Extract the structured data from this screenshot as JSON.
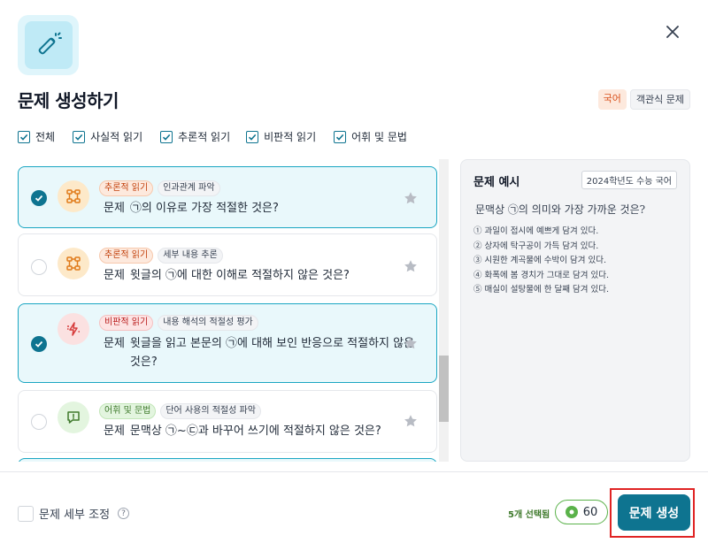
{
  "dialog": {
    "title": "문제 생성하기",
    "tags": {
      "subject": "국어",
      "type": "객관식 문제"
    }
  },
  "filters": [
    {
      "label": "전체",
      "checked": true
    },
    {
      "label": "사실적 읽기",
      "checked": true
    },
    {
      "label": "추론적 읽기",
      "checked": true
    },
    {
      "label": "비판적 읽기",
      "checked": true
    },
    {
      "label": "어휘 및 문법",
      "checked": true
    }
  ],
  "questions": [
    {
      "selected": true,
      "category": "추론적 읽기",
      "subcategory": "인과관계 파악",
      "prefix": "문제",
      "text": "㉠의 이유로 가장 적절한 것은?",
      "icon": "diagram-icon"
    },
    {
      "selected": false,
      "category": "추론적 읽기",
      "subcategory": "세부 내용 추론",
      "prefix": "문제",
      "text": "윗글의 ㉠에 대한 이해로 적절하지 않은 것은?",
      "icon": "diagram-icon"
    },
    {
      "selected": true,
      "category": "비판적 읽기",
      "subcategory": "내용 해석의 적절성 평가",
      "prefix": "문제",
      "text": "윗글을 읽고 본문의 ㉠에 대해 보인 반응으로 적절하지 않은 것은?",
      "icon": "lightning-icon"
    },
    {
      "selected": false,
      "category": "어휘 및 문법",
      "subcategory": "단어 사용의 적절성 파악",
      "prefix": "문제",
      "text": "문맥상 ㉠~㉢과 바꾸어 쓰기에 적절하지 않은 것은?",
      "icon": "chat-icon"
    }
  ],
  "example": {
    "title": "문제 예시",
    "badge": "2024학년도 수능 국어",
    "question": "문맥상 ㉠의 의미와 가장 가까운 것은?",
    "options": [
      "① 과일이 접시에 예쁘게 담겨 있다.",
      "② 상자에 탁구공이 가득 담겨 있다.",
      "③ 시원한 계곡물에 수박이 담겨 있다.",
      "④ 화폭에 봄 경치가 그대로 담겨 있다.",
      "⑤ 매실이 설탕물에 한 달째 담겨 있다."
    ]
  },
  "footer": {
    "detail_label": "문제 세부 조정",
    "help": "?",
    "selected_count": "5개 선택됨",
    "credits": "60",
    "generate_label": "문제 생성"
  },
  "colors": {
    "accent": "#0e7490",
    "selected_bg": "#e9f8fb",
    "selected_border": "#1aa6c2",
    "highlight_outline": "#e02424"
  }
}
